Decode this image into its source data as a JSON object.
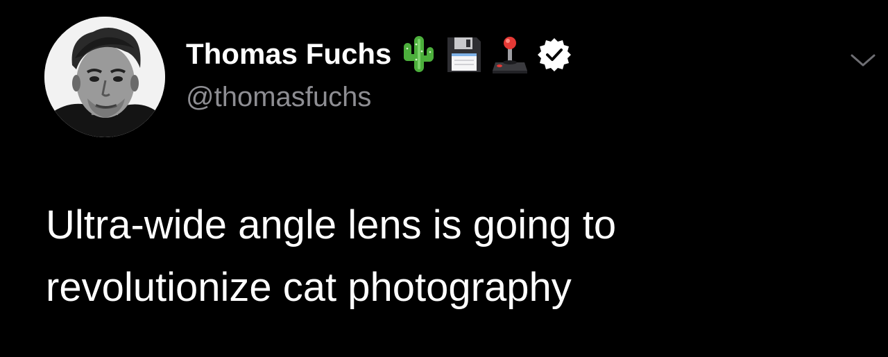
{
  "tweet": {
    "author": {
      "display_name": "Thomas Fuchs",
      "handle": "@thomasfuchs",
      "avatar_icon": "profile-photo",
      "name_emojis": [
        "cactus",
        "floppy-disk",
        "joystick"
      ],
      "verified_icon": "verified-badge-icon"
    },
    "menu_icon": "chevron-down-icon",
    "text_lines": [
      "Ultra-wide angle lens is going to",
      "revolutionize cat photography"
    ]
  },
  "colors": {
    "background": "#000000",
    "primary_text": "#ffffff",
    "secondary_text": "#8e8e93",
    "chevron": "#6e6e73",
    "verified_badge": "#ffffff"
  }
}
